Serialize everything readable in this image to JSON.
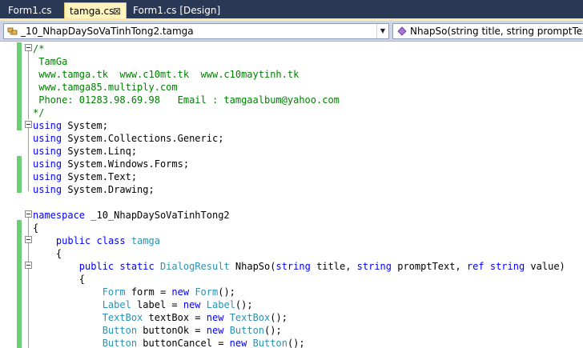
{
  "tabs": [
    {
      "label": "Form1.cs",
      "active": false
    },
    {
      "label": "tamga.cs",
      "active": true,
      "close": "⊠"
    },
    {
      "label": "Form1.cs [Design]",
      "active": false
    }
  ],
  "navbar": {
    "type_selector": "_10_NhapDaySoVaTinhTong2.tamga",
    "member_selector": "NhapSo(string title, string promptText, ref string value)"
  },
  "colors": {
    "comment": "#008000",
    "keyword": "#0000ff",
    "type": "#2b91af",
    "change_bar": "#6ccf76",
    "active_tab": "#fdf4bf",
    "tab_strip": "#293955"
  },
  "code": [
    [
      {
        "t": "/*",
        "c": "cm"
      }
    ],
    [
      {
        "t": " TamGa",
        "c": "cm"
      }
    ],
    [
      {
        "t": " www.tamga.tk  www.c10mt.tk  www.c10maytinh.tk",
        "c": "cm"
      }
    ],
    [
      {
        "t": " www.tamga85.multiply.com",
        "c": "cm"
      }
    ],
    [
      {
        "t": " Phone: 01283.98.69.98   Email : tamgaalbum@yahoo.com",
        "c": "cm"
      }
    ],
    [
      {
        "t": "*/",
        "c": "cm"
      }
    ],
    [
      {
        "t": "using",
        "c": "kw"
      },
      {
        "t": " System;",
        "c": "pl"
      }
    ],
    [
      {
        "t": "using",
        "c": "kw"
      },
      {
        "t": " System.Collections.Generic;",
        "c": "pl"
      }
    ],
    [
      {
        "t": "using",
        "c": "kw"
      },
      {
        "t": " System.Linq;",
        "c": "pl"
      }
    ],
    [
      {
        "t": "using",
        "c": "kw"
      },
      {
        "t": " System.Windows.Forms;",
        "c": "pl"
      }
    ],
    [
      {
        "t": "using",
        "c": "kw"
      },
      {
        "t": " System.Text;",
        "c": "pl"
      }
    ],
    [
      {
        "t": "using",
        "c": "kw"
      },
      {
        "t": " System.Drawing;",
        "c": "pl"
      }
    ],
    [],
    [
      {
        "t": "namespace",
        "c": "kw"
      },
      {
        "t": " _10_NhapDaySoVaTinhTong2",
        "c": "pl"
      }
    ],
    [
      {
        "t": "{",
        "c": "pl"
      }
    ],
    [
      {
        "t": "    ",
        "c": "pl"
      },
      {
        "t": "public",
        "c": "kw"
      },
      {
        "t": " ",
        "c": "pl"
      },
      {
        "t": "class",
        "c": "kw"
      },
      {
        "t": " ",
        "c": "pl"
      },
      {
        "t": "tamga",
        "c": "ty"
      }
    ],
    [
      {
        "t": "    {",
        "c": "pl"
      }
    ],
    [
      {
        "t": "        ",
        "c": "pl"
      },
      {
        "t": "public",
        "c": "kw"
      },
      {
        "t": " ",
        "c": "pl"
      },
      {
        "t": "static",
        "c": "kw"
      },
      {
        "t": " ",
        "c": "pl"
      },
      {
        "t": "DialogResult",
        "c": "ty"
      },
      {
        "t": " NhapSo(",
        "c": "pl"
      },
      {
        "t": "string",
        "c": "kw"
      },
      {
        "t": " title, ",
        "c": "pl"
      },
      {
        "t": "string",
        "c": "kw"
      },
      {
        "t": " promptText, ",
        "c": "pl"
      },
      {
        "t": "ref",
        "c": "kw"
      },
      {
        "t": " ",
        "c": "pl"
      },
      {
        "t": "string",
        "c": "kw"
      },
      {
        "t": " value)",
        "c": "pl"
      }
    ],
    [
      {
        "t": "        {",
        "c": "pl"
      }
    ],
    [
      {
        "t": "            ",
        "c": "pl"
      },
      {
        "t": "Form",
        "c": "ty"
      },
      {
        "t": " form = ",
        "c": "pl"
      },
      {
        "t": "new",
        "c": "kw"
      },
      {
        "t": " ",
        "c": "pl"
      },
      {
        "t": "Form",
        "c": "ty"
      },
      {
        "t": "();",
        "c": "pl"
      }
    ],
    [
      {
        "t": "            ",
        "c": "pl"
      },
      {
        "t": "Label",
        "c": "ty"
      },
      {
        "t": " label = ",
        "c": "pl"
      },
      {
        "t": "new",
        "c": "kw"
      },
      {
        "t": " ",
        "c": "pl"
      },
      {
        "t": "Label",
        "c": "ty"
      },
      {
        "t": "();",
        "c": "pl"
      }
    ],
    [
      {
        "t": "            ",
        "c": "pl"
      },
      {
        "t": "TextBox",
        "c": "ty"
      },
      {
        "t": " textBox = ",
        "c": "pl"
      },
      {
        "t": "new",
        "c": "kw"
      },
      {
        "t": " ",
        "c": "pl"
      },
      {
        "t": "TextBox",
        "c": "ty"
      },
      {
        "t": "();",
        "c": "pl"
      }
    ],
    [
      {
        "t": "            ",
        "c": "pl"
      },
      {
        "t": "Button",
        "c": "ty"
      },
      {
        "t": " buttonOk = ",
        "c": "pl"
      },
      {
        "t": "new",
        "c": "kw"
      },
      {
        "t": " ",
        "c": "pl"
      },
      {
        "t": "Button",
        "c": "ty"
      },
      {
        "t": "();",
        "c": "pl"
      }
    ],
    [
      {
        "t": "            ",
        "c": "pl"
      },
      {
        "t": "Button",
        "c": "ty"
      },
      {
        "t": " buttonCancel = ",
        "c": "pl"
      },
      {
        "t": "new",
        "c": "kw"
      },
      {
        "t": " ",
        "c": "pl"
      },
      {
        "t": "Button",
        "c": "ty"
      },
      {
        "t": "();",
        "c": "pl"
      }
    ]
  ]
}
